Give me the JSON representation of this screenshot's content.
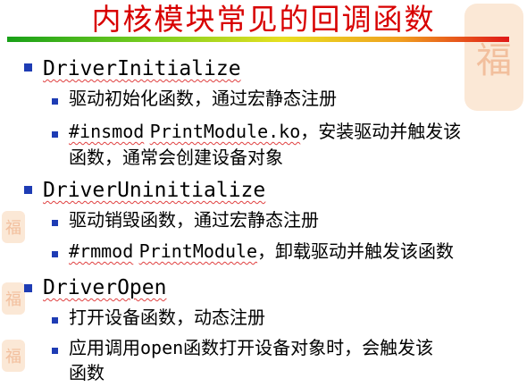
{
  "title": "内核模块常见的回调函数",
  "items": [
    {
      "heading": "DriverInitialize",
      "subitems": [
        {
          "text": "驱动初始化函数，通过宏静态注册"
        },
        {
          "cmd": "#insmod",
          "arg": "PrintModule.ko",
          "line1_rest": "，安装驱动并触发该",
          "line2": "函数，通常会创建设备对象"
        }
      ]
    },
    {
      "heading": "DriverUninitialize",
      "subitems": [
        {
          "text": "驱动销毁函数，通过宏静态注册"
        },
        {
          "cmd": "#rmmod",
          "arg": "PrintModule",
          "line1_rest": "，卸载驱动并触发该函数"
        }
      ]
    },
    {
      "heading": "DriverOpen",
      "subitems": [
        {
          "text": "打开设备函数，动态注册"
        },
        {
          "pre": "应用调用",
          "code": "open",
          "post": "函数打开设备对象时，会触发该",
          "line2": "函数"
        }
      ]
    }
  ],
  "colors": {
    "title": "#d80000",
    "bullet": "#1e3cb4"
  },
  "icons": {
    "stamp": "seal-watermark-icon"
  }
}
